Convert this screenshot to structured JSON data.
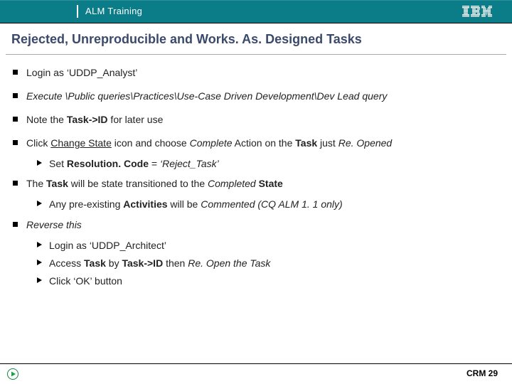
{
  "header": {
    "course_label": "ALM Training"
  },
  "slide": {
    "title": "Rejected, Unreproducible and Works. As. Designed Tasks"
  },
  "bullets": [
    {
      "runs": [
        {
          "t": "Login as "
        },
        {
          "t": "‘UDDP_Analyst’"
        }
      ]
    },
    {
      "runs": [
        {
          "t": "Execute ",
          "i": true
        },
        {
          "t": "\\Public queries\\Practices\\Use-Case Driven Development\\Dev Lead query",
          "i": true
        }
      ]
    },
    {
      "runs": [
        {
          "t": "Note the "
        },
        {
          "t": "Task->ID",
          "b": true
        },
        {
          "t": " for later use"
        }
      ]
    },
    {
      "runs": [
        {
          "t": "Click "
        },
        {
          "t": "Change State",
          "u": true
        },
        {
          "t": " icon and choose "
        },
        {
          "t": "Complete",
          "i": true
        },
        {
          "t": " Action on the "
        },
        {
          "t": "Task",
          "b": true
        },
        {
          "t": " just "
        },
        {
          "t": "Re. Opened",
          "i": true
        }
      ],
      "subs": [
        {
          "runs": [
            {
              "t": "Set  "
            },
            {
              "t": "Resolution. Code",
              "b": true
            },
            {
              "t": " = "
            },
            {
              "t": "‘Reject_Task’",
              "i": true
            }
          ]
        }
      ]
    },
    {
      "runs": [
        {
          "t": "The "
        },
        {
          "t": "Task",
          "b": true
        },
        {
          "t": " will be state transitioned to the "
        },
        {
          "t": "Completed",
          "i": true
        },
        {
          "t": " "
        },
        {
          "t": "State",
          "b": true
        }
      ],
      "subs": [
        {
          "runs": [
            {
              "t": "Any pre-existing "
            },
            {
              "t": "Activities",
              "b": true
            },
            {
              "t": " will be "
            },
            {
              "t": "Commented (CQ ALM 1. 1 only)",
              "i": true
            }
          ]
        }
      ]
    },
    {
      "runs": [
        {
          "t": "Reverse this",
          "i": true
        }
      ],
      "subs": [
        {
          "runs": [
            {
              "t": "Login as ‘UDDP_Architect’"
            }
          ]
        },
        {
          "runs": [
            {
              "t": "Access "
            },
            {
              "t": "Task",
              "b": true
            },
            {
              "t": " by "
            },
            {
              "t": "Task->ID",
              "b": true
            },
            {
              "t": " then "
            },
            {
              "t": "Re. Open the Task",
              "i": true
            }
          ]
        },
        {
          "runs": [
            {
              "t": "Click ‘OK’ button"
            }
          ]
        }
      ]
    }
  ],
  "footer": {
    "page_label": "CRM 29"
  }
}
